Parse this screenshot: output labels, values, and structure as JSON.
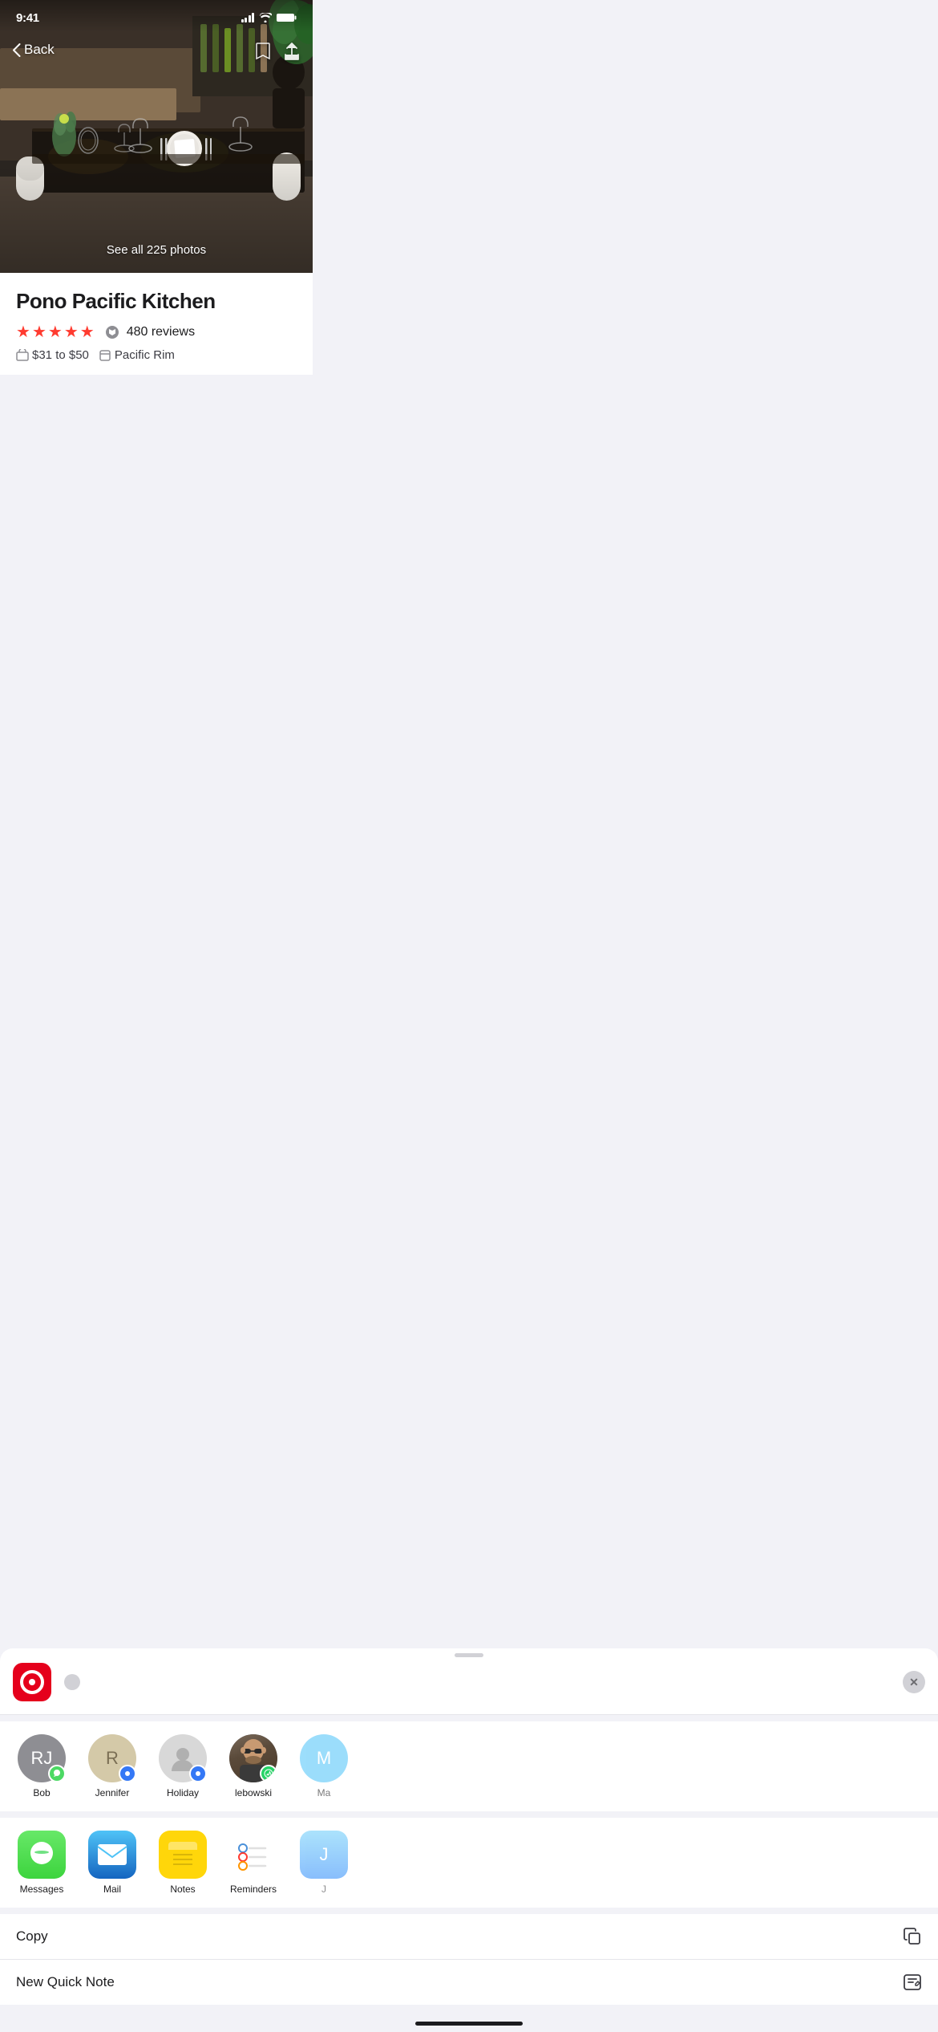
{
  "statusBar": {
    "time": "9:41",
    "signal": 4,
    "wifi": true,
    "battery": "full"
  },
  "hero": {
    "seeAllPhotos": "See all 225 photos",
    "backLabel": "Back"
  },
  "restaurant": {
    "name": "Pono Pacific Kitchen",
    "stars": 5,
    "reviewCount": "480 reviews",
    "priceRange": "$31 to $50",
    "cuisine": "Pacific Rim"
  },
  "shareSheet": {
    "closeLabel": "✕"
  },
  "contacts": [
    {
      "id": "bob",
      "initials": "RJ",
      "name": "Bob",
      "colorClass": "rj",
      "badge": "messages"
    },
    {
      "id": "jennifer",
      "initials": "R",
      "name": "Jennifer",
      "colorClass": "r",
      "badge": "signal"
    },
    {
      "id": "holiday",
      "initials": "",
      "name": "Holiday",
      "colorClass": "holiday",
      "badge": "signal"
    },
    {
      "id": "lebowski",
      "initials": "",
      "name": "lebowski",
      "colorClass": "lebowski",
      "badge": "whatsapp"
    },
    {
      "id": "ma",
      "initials": "M",
      "name": "Ma",
      "colorClass": "ma",
      "badge": ""
    }
  ],
  "apps": [
    {
      "id": "messages",
      "name": "Messages",
      "iconClass": "messages"
    },
    {
      "id": "mail",
      "name": "Mail",
      "iconClass": "mail"
    },
    {
      "id": "notes",
      "name": "Notes",
      "iconClass": "notes"
    },
    {
      "id": "reminders",
      "name": "Reminders",
      "iconClass": "reminders"
    }
  ],
  "actions": [
    {
      "id": "copy",
      "label": "Copy",
      "iconType": "copy"
    },
    {
      "id": "new-quick-note",
      "label": "New Quick Note",
      "iconType": "quicknote"
    }
  ]
}
